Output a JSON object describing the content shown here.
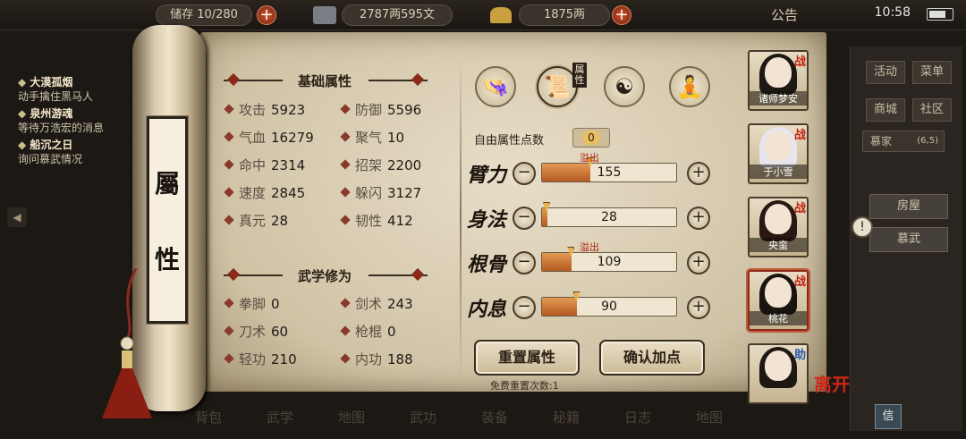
{
  "topbar": {
    "capacity": "储存 10/280",
    "money": "2787两595文",
    "gold": "1875两",
    "notice": "公告",
    "time": "10:58"
  },
  "quests": [
    {
      "title": "大漠孤烟",
      "desc": "动手擒住黑马人"
    },
    {
      "title": "泉州游魂",
      "desc": "等待万浩宏的消息"
    },
    {
      "title": "船沉之日",
      "desc": "询问慕武情况"
    }
  ],
  "scroll": {
    "label_1": "屬",
    "label_2": "性"
  },
  "basic": {
    "title": "基础属性",
    "stats": [
      {
        "label": "攻击",
        "value": "5923"
      },
      {
        "label": "防御",
        "value": "5596"
      },
      {
        "label": "气血",
        "value": "16279"
      },
      {
        "label": "聚气",
        "value": "10"
      },
      {
        "label": "命中",
        "value": "2314"
      },
      {
        "label": "招架",
        "value": "2200"
      },
      {
        "label": "速度",
        "value": "2845"
      },
      {
        "label": "躲闪",
        "value": "3127"
      },
      {
        "label": "真元",
        "value": "28"
      },
      {
        "label": "韧性",
        "value": "412"
      }
    ]
  },
  "martial": {
    "title": "武学修为",
    "stats": [
      {
        "label": "拳脚",
        "value": "0"
      },
      {
        "label": "剑术",
        "value": "243"
      },
      {
        "label": "刀术",
        "value": "60"
      },
      {
        "label": "枪棍",
        "value": "0"
      },
      {
        "label": "轻功",
        "value": "210"
      },
      {
        "label": "内功",
        "value": "188"
      }
    ]
  },
  "tabs": {
    "active_label": "属性"
  },
  "free_points": {
    "label": "自由属性点数",
    "value": "0"
  },
  "attributes": [
    {
      "name": "臂力",
      "value": "155",
      "fill": 0.36,
      "overflow": "溢出"
    },
    {
      "name": "身法",
      "value": "28",
      "fill": 0.04,
      "overflow": ""
    },
    {
      "name": "根骨",
      "value": "109",
      "fill": 0.22,
      "overflow": "溢出"
    },
    {
      "name": "内息",
      "value": "90",
      "fill": 0.26,
      "overflow": ""
    }
  ],
  "buttons": {
    "reset": "重置属性",
    "confirm": "确认加点",
    "free_reset": "免费重置次数:1"
  },
  "characters": [
    {
      "name": "诸师梦安",
      "badge": "战"
    },
    {
      "name": "于小雪",
      "badge": "战"
    },
    {
      "name": "央蛮",
      "badge": "战"
    },
    {
      "name": "桃花",
      "badge": "战"
    },
    {
      "name": "",
      "badge": "助"
    }
  ],
  "right_menu": {
    "activity": "活动",
    "menu": "菜单",
    "shop": "商城",
    "community": "社区",
    "family": "慕家",
    "family_count": "(6,5)",
    "house": "房屋",
    "mu_wu": "慕武",
    "leave": "离开",
    "mail": "信"
  },
  "bottom": [
    "背包",
    "武学",
    "地图",
    "武功",
    "装备",
    "秘籍",
    "日志",
    "地图"
  ],
  "colors": {
    "accent": "#b02410",
    "bar_fill": "#c8702e",
    "paper": "#ddd1b8"
  }
}
